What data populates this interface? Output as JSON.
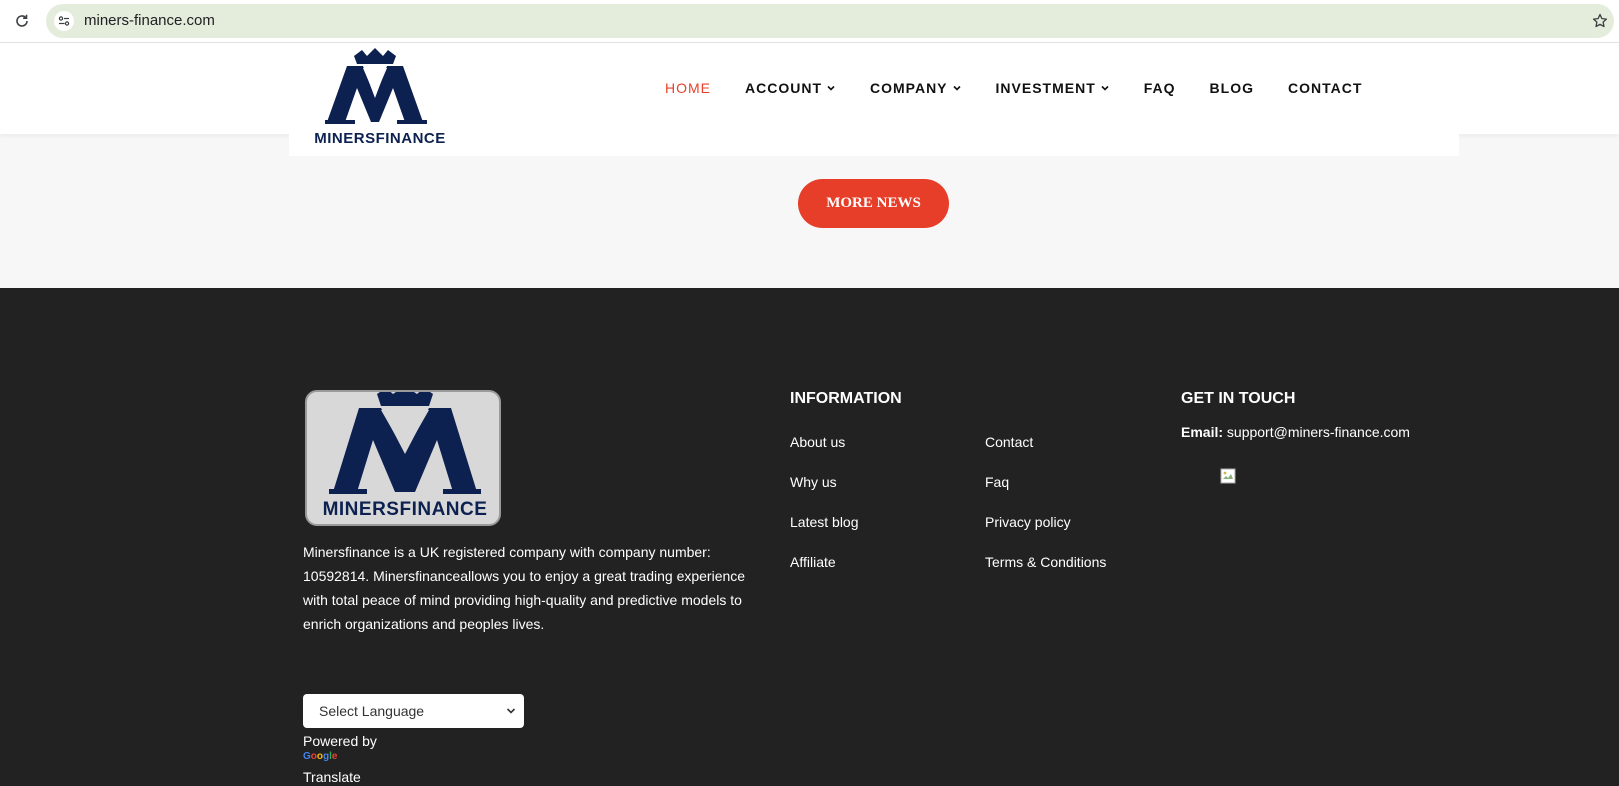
{
  "browser": {
    "url": "miners-finance.com",
    "icons": {
      "reload": "reload-icon",
      "site_info": "site-info-icon",
      "bookmark": "star-icon"
    }
  },
  "header": {
    "logo_text": "MINERSFINANCE",
    "nav": [
      {
        "label": "HOME",
        "active": true,
        "dropdown": false
      },
      {
        "label": "ACCOUNT",
        "active": false,
        "dropdown": true
      },
      {
        "label": "COMPANY",
        "active": false,
        "dropdown": true
      },
      {
        "label": "INVESTMENT",
        "active": false,
        "dropdown": true
      },
      {
        "label": "FAQ",
        "active": false,
        "dropdown": false
      },
      {
        "label": "BLOG",
        "active": false,
        "dropdown": false
      },
      {
        "label": "CONTACT",
        "active": false,
        "dropdown": false
      }
    ]
  },
  "main": {
    "more_news_label": "MORE NEWS"
  },
  "footer": {
    "logo_text": "MINERSFINANCE",
    "about": "Minersfinance is a UK registered company with company number: 10592814. Minersfinanceallows you to enjoy a great trading experience with total peace of mind providing high-quality and predictive models to enrich organizations and peoples lives.",
    "information_title": "INFORMATION",
    "links_col1": [
      "About us",
      "Why us",
      "Latest blog",
      "Affiliate"
    ],
    "links_col2": [
      "Contact",
      "Faq",
      "Privacy policy",
      "Terms & Conditions"
    ],
    "contact_title": "GET IN TOUCH",
    "email_label": "Email:",
    "email_value": "support@miners-finance.com",
    "language_select": "Select Language",
    "powered_by": "Powered by",
    "google": "Google",
    "translate": "Translate"
  },
  "colors": {
    "accent": "#e63e28",
    "navy": "#0c2150",
    "footer_bg": "#222222",
    "page_bg": "#f7f7f7"
  }
}
